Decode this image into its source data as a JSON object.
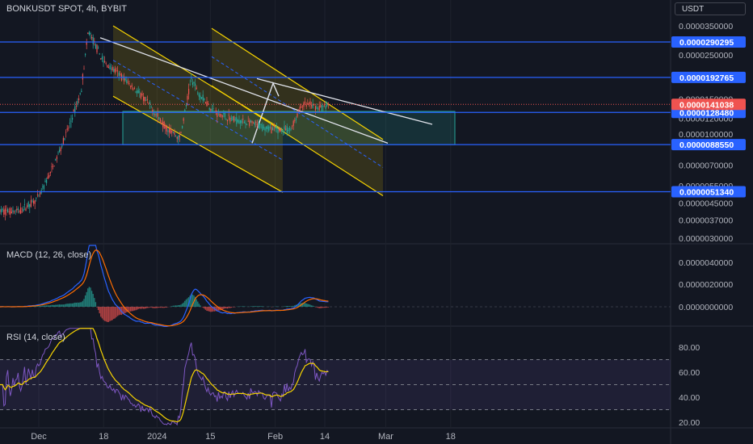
{
  "header": {
    "title": "BONKUSDT SPOT, 4h, BYBIT",
    "currency": "USDT"
  },
  "colors": {
    "bg": "#131722",
    "up": "#26a69a",
    "down": "#ef5350",
    "level": "#2962ff",
    "channel": "#f7d400",
    "trend": "#e0e3eb",
    "macd": "#2962ff",
    "signal": "#ff6d00",
    "rsi": "#7e57c2",
    "rsi_ma": "#f7d400"
  },
  "chart_data": [
    {
      "type": "candlestick",
      "title": "BONKUSDT SPOT, 4h, BYBIT",
      "price_axis_ticks": [
        "0.0000350000",
        "0.0000250000",
        "0.0000150000",
        "0.0000120000",
        "0.0000100000",
        "0.0000070000",
        "0.0000055000",
        "0.0000045000",
        "0.0000037000",
        "0.0000030000"
      ],
      "horizontal_levels": [
        "0.0000290295",
        "0.0000192765",
        "0.0000128480",
        "0.0000088550",
        "0.0000051340"
      ],
      "last_price": "0.0000141038",
      "x_ticks": [
        "Dec",
        "18",
        "2024",
        "15",
        "Feb",
        "14",
        "Mar",
        "18"
      ],
      "series_approx": {
        "x": [
          "Nov 26",
          "Dec 1",
          "Dec 5",
          "Dec 9",
          "Dec 12",
          "Dec 14",
          "Dec 18",
          "Dec 22",
          "Dec 26",
          "Dec 30",
          "Jan 3",
          "Jan 7",
          "Jan 10",
          "Jan 12",
          "Jan 16",
          "Jan 20",
          "Jan 24",
          "Jan 28",
          "Feb 1",
          "Feb 5",
          "Feb 8",
          "Feb 10",
          "Feb 13",
          "Feb 15"
        ],
        "close": [
          4.1e-06,
          4.8e-06,
          7e-06,
          1.1e-05,
          1.6e-05,
          3.3e-05,
          2.3e-05,
          2e-05,
          1.7e-05,
          1.4e-05,
          1.1e-05,
          9.5e-06,
          1.9e-05,
          1.6e-05,
          1.3e-05,
          1.2e-05,
          1.15e-05,
          1.1e-05,
          1.05e-05,
          1.05e-05,
          1.4e-05,
          1.4e-05,
          1.35e-05,
          1.41e-05
        ]
      }
    },
    {
      "type": "line",
      "title": "MACD (12, 26, close)",
      "ticks": [
        "0.0000040000",
        "0.0000020000",
        "0.0000000000"
      ]
    },
    {
      "type": "line",
      "title": "RSI (14, close)",
      "ticks": [
        "80.00",
        "60.00",
        "40.00",
        "20.00"
      ]
    }
  ]
}
